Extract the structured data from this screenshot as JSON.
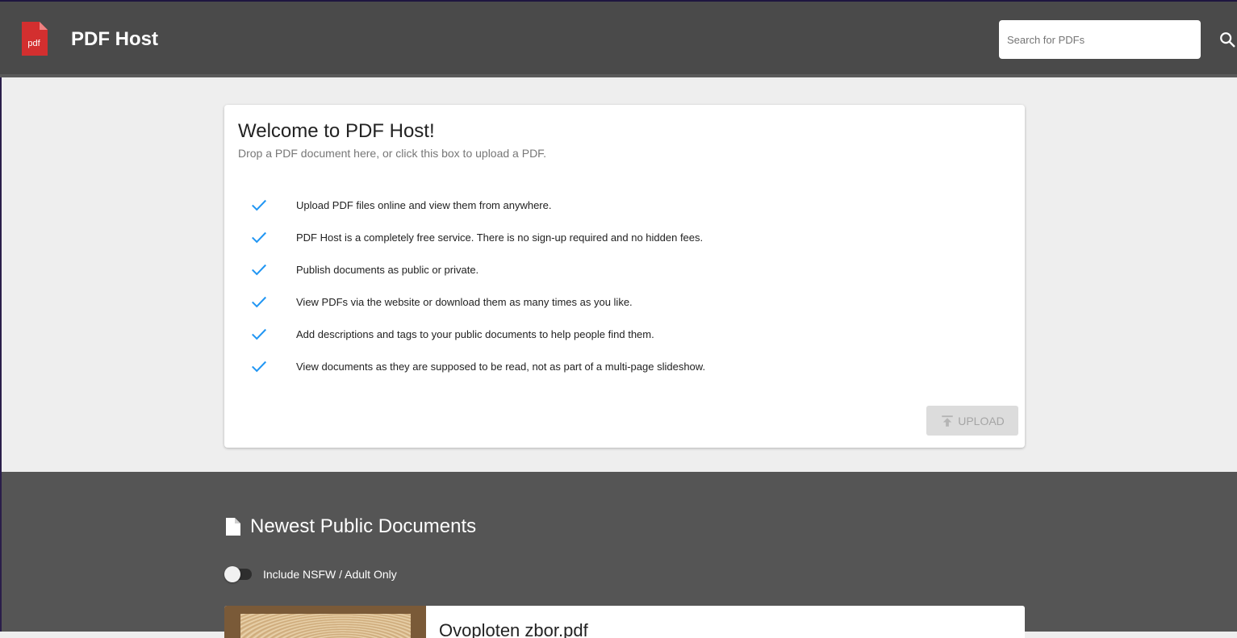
{
  "header": {
    "logo_text": "pdf",
    "title": "PDF Host",
    "search_placeholder": "Search for PDFs",
    "search_icon": "search-icon"
  },
  "welcome": {
    "title": "Welcome to PDF Host!",
    "subtitle": "Drop a PDF document here, or click this box to upload a PDF.",
    "features": [
      "Upload PDF files online and view them from anywhere.",
      "PDF Host is a completely free service. There is no sign-up required and no hidden fees.",
      "Publish documents as public or private.",
      "View PDFs via the website or download them as many times as you like.",
      "Add descriptions and tags to your public documents to help people find them.",
      "View documents as they are supposed to be read, not as part of a multi-page slideshow."
    ],
    "check_icon": "check-icon",
    "upload_label": "UPLOAD",
    "upload_icon": "upload-icon"
  },
  "newest": {
    "title": "Newest Public Documents",
    "title_icon": "file-icon",
    "nsfw_label": "Include NSFW / Adult Only",
    "nsfw_enabled": false,
    "documents": [
      {
        "title": "Ovoploten zbor.pdf"
      }
    ]
  },
  "colors": {
    "header_bg": "#4a4a4a",
    "dark_section_bg": "#555555",
    "check_color": "#2196f3",
    "logo_red": "#d32f2f"
  }
}
